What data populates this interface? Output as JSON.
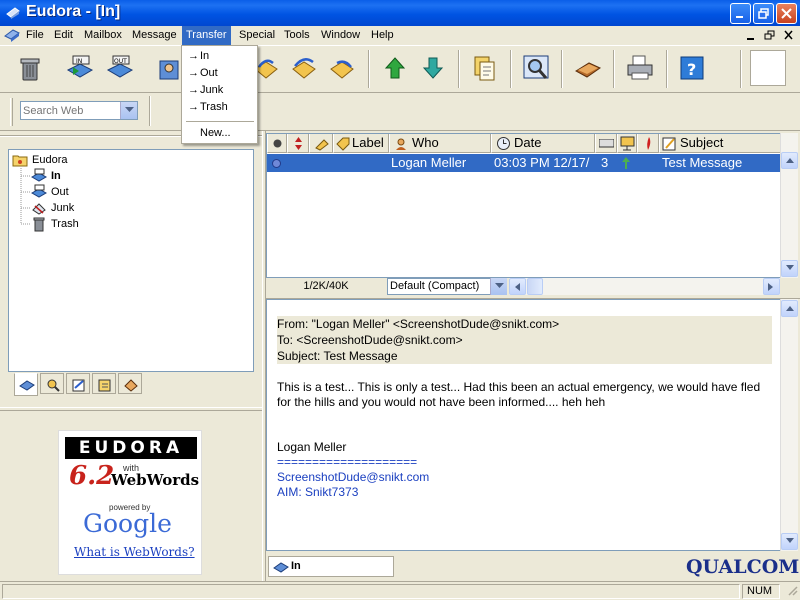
{
  "window": {
    "title": "Eudora - [In]"
  },
  "menu": [
    {
      "label": "File"
    },
    {
      "label": "Edit"
    },
    {
      "label": "Mailbox"
    },
    {
      "label": "Message"
    },
    {
      "label": "Transfer"
    },
    {
      "label": "Special"
    },
    {
      "label": "Tools"
    },
    {
      "label": "Window"
    },
    {
      "label": "Help"
    }
  ],
  "transfer_menu": {
    "items": [
      {
        "label": "In"
      },
      {
        "label": "Out"
      },
      {
        "label": "Junk"
      },
      {
        "label": "Trash"
      }
    ],
    "new_label": "New...",
    "arrow_glyph": "→"
  },
  "search": {
    "placeholder": "Search Web"
  },
  "tree": {
    "root": "Eudora",
    "items": [
      {
        "label": "In"
      },
      {
        "label": "Out"
      },
      {
        "label": "Junk"
      },
      {
        "label": "Trash"
      }
    ]
  },
  "ad": {
    "brand": "EUDORA",
    "version": "6.2",
    "with": "with",
    "product": "WebWords",
    "powered_by": "powered by",
    "google": "Google",
    "link": "What is WebWords?"
  },
  "columns": {
    "label": "Label",
    "who": "Who",
    "date": "Date",
    "subject": "Subject"
  },
  "message_row": {
    "who": "Logan Meller",
    "date": "03:03 PM 12/17/",
    "size": "3",
    "subject": "Test Message"
  },
  "list_status": {
    "size": "1/2K/40K",
    "view": "Default (Compact)"
  },
  "preview": {
    "from": "From: \"Logan Meller\" <ScreenshotDude@snikt.com>",
    "to": "To: <ScreenshotDude@snikt.com>",
    "subject": "Subject: Test Message",
    "body_line1": "This is a test... This is only a test... Had this been an actual emergency, we would have fled",
    "body_line2": "for the hills and you would not have been informed.... heh heh",
    "sig_name": "Logan Meller",
    "sig_rule": "====================",
    "sig_email": "ScreenshotDude@snikt.com",
    "sig_aim": "AIM: Snikt7373"
  },
  "bottom_tab": {
    "label": "In"
  },
  "logo": "QUALCOMM",
  "status": {
    "num": "NUM"
  },
  "colors": {
    "selection": "#316ac5",
    "titlebar": "#0054e3",
    "link": "#1a3fc0",
    "face": "#ece9d8"
  }
}
